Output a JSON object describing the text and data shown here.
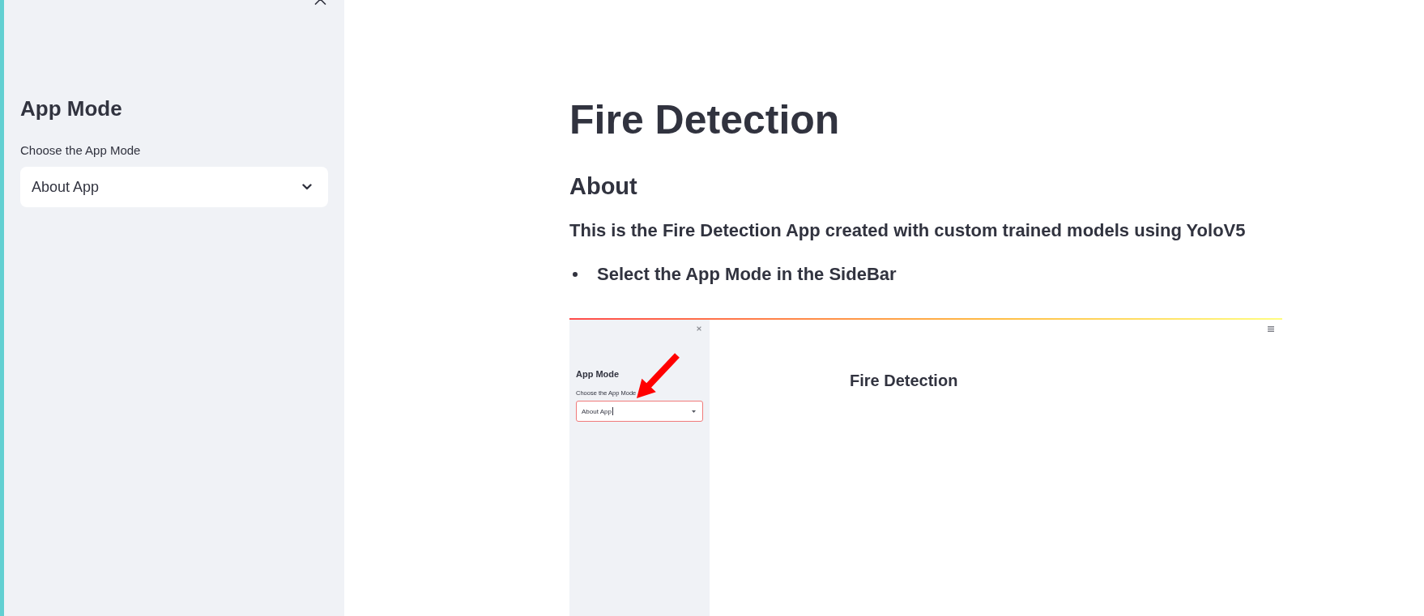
{
  "sidebar": {
    "title": "App Mode",
    "select": {
      "label": "Choose the App Mode",
      "value": "About App"
    }
  },
  "main": {
    "title": "Fire Detection",
    "subheader": "About",
    "description": "This is the Fire Detection App created with custom trained models using YoloV5",
    "bullets": [
      "Select the App Mode in the SideBar"
    ],
    "screenshot": {
      "sidebar": {
        "title": "App Mode",
        "select": {
          "label": "Choose the App Mode",
          "value": "About App",
          "focused": true
        }
      },
      "title": "Fire Detection"
    }
  }
}
